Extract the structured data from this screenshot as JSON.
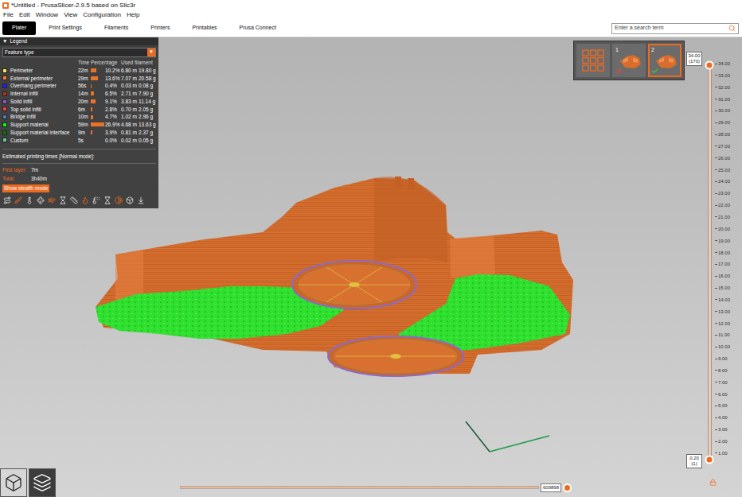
{
  "window": {
    "title": "*Untitled - PrusaSlicer-2.9.5 based on Slic3r"
  },
  "menu": [
    "File",
    "Edit",
    "Window",
    "View",
    "Configuration",
    "Help"
  ],
  "tabs": [
    {
      "label": "Plater",
      "selected": true
    },
    {
      "label": "Print Settings",
      "selected": false
    },
    {
      "label": "Filaments",
      "selected": false
    },
    {
      "label": "Printers",
      "selected": false
    },
    {
      "label": "Printables",
      "selected": false
    },
    {
      "label": "Prusa Connect",
      "selected": false
    }
  ],
  "search": {
    "placeholder": "Enter a search term"
  },
  "legend": {
    "expander": "▼",
    "title": "Legend",
    "view_type": "Feature type",
    "dropdown_arrow": "▼",
    "columns": [
      "Time",
      "Percentage",
      "Used filament"
    ],
    "items": [
      {
        "name": "Perimeter",
        "time": "22m",
        "percentage": "10.2%",
        "length": "6.80 m",
        "weight": "19.80 g",
        "level": 0.102,
        "color": "#ffe64d"
      },
      {
        "name": "External perimeter",
        "time": "29m",
        "percentage": "13.6%",
        "length": "7.07 m",
        "weight": "20.58 g",
        "level": 0.136,
        "color": "#ff7d38"
      },
      {
        "name": "Overhang perimeter",
        "time": "56s",
        "percentage": "0.4%",
        "length": "0.03 m",
        "weight": "0.08 g",
        "level": 0.004,
        "color": "#1f1fff"
      },
      {
        "name": "Internal infill",
        "time": "14m",
        "percentage": "6.5%",
        "length": "2.71 m",
        "weight": "7.90 g",
        "level": 0.065,
        "color": "#b03029"
      },
      {
        "name": "Solid infill",
        "time": "20m",
        "percentage": "9.1%",
        "length": "3.83 m",
        "weight": "11.14 g",
        "level": 0.091,
        "color": "#9654cc"
      },
      {
        "name": "Top solid infill",
        "time": "6m",
        "percentage": "2.8%",
        "length": "0.70 m",
        "weight": "2.05 g",
        "level": 0.028,
        "color": "#f04040"
      },
      {
        "name": "Bridge infill",
        "time": "10m",
        "percentage": "4.7%",
        "length": "1.02 m",
        "weight": "2.96 g",
        "level": 0.047,
        "color": "#4d80ba"
      },
      {
        "name": "Support material",
        "time": "59m",
        "percentage": "26.9%",
        "length": "4.68 m",
        "weight": "13.63 g",
        "level": 0.269,
        "color": "#00ff00"
      },
      {
        "name": "Support material interface",
        "time": "9m",
        "percentage": "3.9%",
        "length": "0.81 m",
        "weight": "2.37 g",
        "level": 0.039,
        "color": "#008000"
      },
      {
        "name": "Custom",
        "time": "5s",
        "percentage": "0.0%",
        "length": "0.02 m",
        "weight": "0.05 g",
        "level": 0.0,
        "color": "#5ed194"
      }
    ]
  },
  "estimates": {
    "title": "Estimated printing times [Normal mode]:",
    "rows": [
      {
        "label": "First layer:",
        "value": "7m"
      },
      {
        "label": "Total:",
        "value": "3h40m"
      }
    ],
    "button": "Show stealth mode"
  },
  "beds": [
    {
      "label": "1",
      "selected": false,
      "valid": false
    },
    {
      "label": "2",
      "selected": true,
      "valid": true
    }
  ],
  "layer_slider": {
    "upper": {
      "value": "34.00",
      "layer": "(170)",
      "level": 1
    },
    "lower": {
      "value": "0.20",
      "layer": "(1)",
      "level": 0
    },
    "ticks": [
      "34.00",
      "33.00",
      "32.00",
      "31.00",
      "30.00",
      "29.00",
      "28.00",
      "27.00",
      "26.00",
      "25.00",
      "24.00",
      "23.00",
      "22.00",
      "21.00",
      "20.00",
      "19.00",
      "18.00",
      "17.00",
      "16.00",
      "15.00",
      "14.00",
      "13.00",
      "12.00",
      "11.00",
      "10.00",
      "9.00",
      "8.00",
      "7.00",
      "6.00",
      "5.00",
      "4.00",
      "3.00",
      "2.00",
      "1.00"
    ]
  },
  "move_slider": {
    "value": "609898",
    "level": 1
  },
  "view_modes": [
    {
      "kind": "3d",
      "selected": false
    },
    {
      "kind": "preview",
      "selected": true
    }
  ]
}
